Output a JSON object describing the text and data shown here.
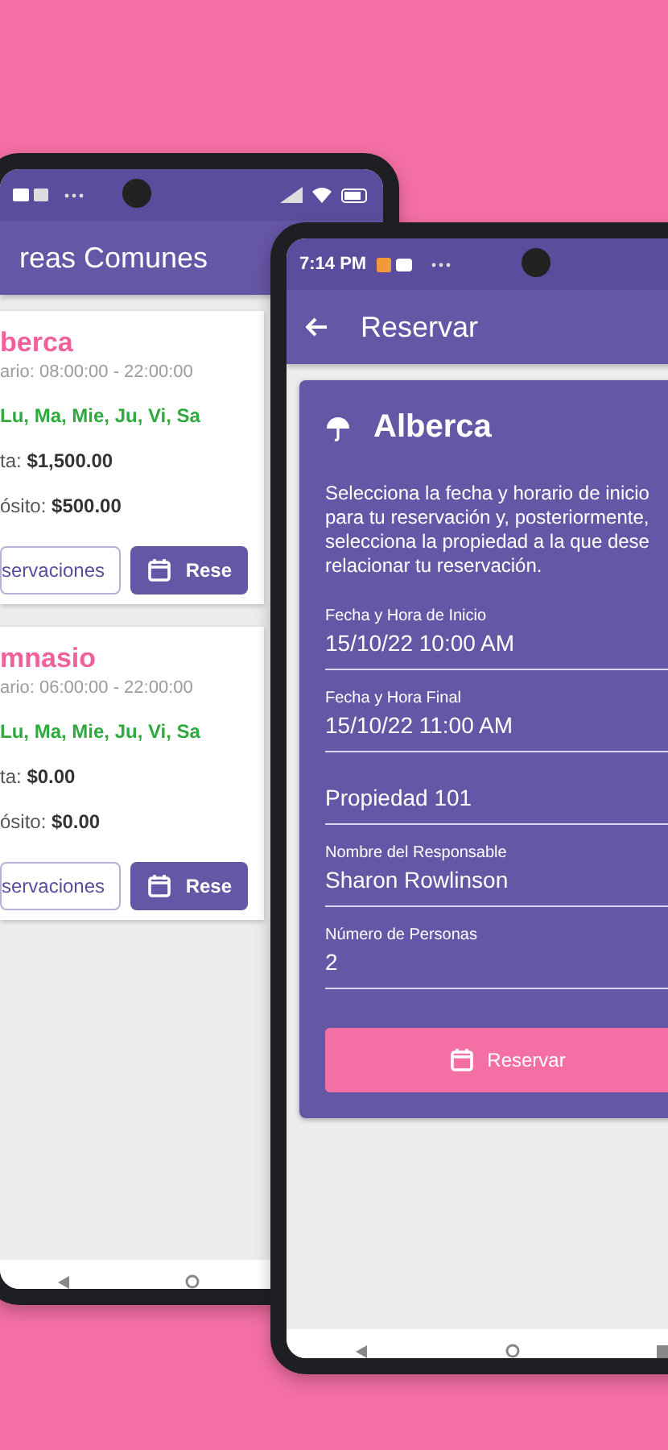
{
  "back_screen": {
    "title": "reas Comunes",
    "cards": [
      {
        "name": "berca",
        "schedule": "ario: 08:00:00 - 22:00:00",
        "days": "Lu, Ma, Mie, Ju, Vi, Sa",
        "fee_label": "ta:",
        "fee": "$1,500.00",
        "deposit_label": "ósito:",
        "deposit": "$500.00",
        "list_button": "servaciones",
        "reserve_button": "Rese"
      },
      {
        "name": "mnasio",
        "schedule": "ario: 06:00:00 - 22:00:00",
        "days": "Lu, Ma, Mie, Ju, Vi, Sa",
        "fee_label": "ta:",
        "fee": "$0.00",
        "deposit_label": "ósito:",
        "deposit": "$0.00",
        "list_button": "servaciones",
        "reserve_button": "Rese"
      }
    ]
  },
  "front_screen": {
    "status_time": "7:14 PM",
    "title": "Reservar",
    "card": {
      "title": "Alberca",
      "description_lines": [
        "Selecciona la fecha y horario de inicio",
        "para tu reservación y, posteriormente,",
        "selecciona la propiedad a la que dese",
        "relacionar tu reservación."
      ],
      "fields": [
        {
          "label": "Fecha y Hora de Inicio",
          "value": "15/10/22 10:00 AM"
        },
        {
          "label": "Fecha y Hora Final",
          "value": "15/10/22 11:00 AM"
        },
        {
          "value": "Propiedad 101"
        },
        {
          "label": "Nombre del Responsable",
          "value": "Sharon Rowlinson"
        },
        {
          "label": "Número de Personas",
          "value": "2"
        }
      ],
      "button": "Reservar"
    }
  }
}
